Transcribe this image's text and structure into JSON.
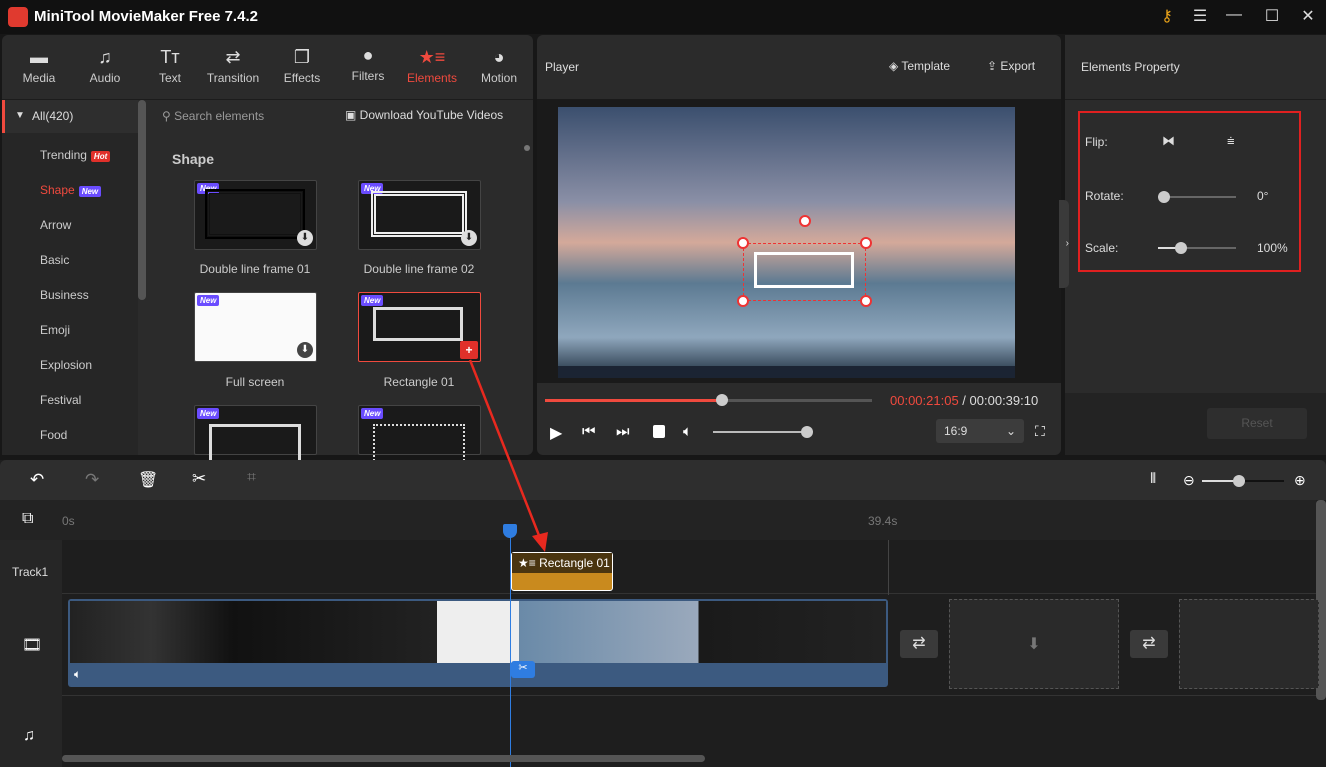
{
  "app": {
    "title": "MiniTool MovieMaker Free 7.4.2"
  },
  "toolbar": [
    {
      "label": "Media",
      "icon": "folder-icon"
    },
    {
      "label": "Audio",
      "icon": "music-icon"
    },
    {
      "label": "Text",
      "icon": "text-icon"
    },
    {
      "label": "Transition",
      "icon": "transition-icon"
    },
    {
      "label": "Effects",
      "icon": "effects-icon"
    },
    {
      "label": "Filters",
      "icon": "filters-icon"
    },
    {
      "label": "Elements",
      "icon": "elements-icon",
      "active": true
    },
    {
      "label": "Motion",
      "icon": "motion-icon"
    }
  ],
  "categories": {
    "all": "All(420)",
    "items": [
      {
        "label": "Trending",
        "badge": "Hot"
      },
      {
        "label": "Shape",
        "badge": "New",
        "active": true
      },
      {
        "label": "Arrow"
      },
      {
        "label": "Basic"
      },
      {
        "label": "Business"
      },
      {
        "label": "Emoji"
      },
      {
        "label": "Explosion"
      },
      {
        "label": "Festival"
      },
      {
        "label": "Food"
      }
    ]
  },
  "search": {
    "placeholder": "Search elements",
    "download": "Download YouTube Videos"
  },
  "section": "Shape",
  "elements": [
    {
      "name": "Double line frame 01",
      "tag": "New"
    },
    {
      "name": "Double line frame 02",
      "tag": "New"
    },
    {
      "name": "Full screen",
      "tag": "New"
    },
    {
      "name": "Rectangle 01",
      "tag": "New",
      "selected": true
    },
    {
      "tag": "New"
    },
    {
      "tag": "New"
    }
  ],
  "player": {
    "title": "Player",
    "template": "Template",
    "export": "Export",
    "current": "00:00:21:05",
    "separator": " / ",
    "total": "00:00:39:10",
    "progress": 0.54,
    "volume": 1.0,
    "aspect": "16:9"
  },
  "property": {
    "title": "Elements Property",
    "flip": "Flip:",
    "rotate": "Rotate:",
    "rotate_value": "0°",
    "rotate_level": 0,
    "scale": "Scale:",
    "scale_value": "100%",
    "scale_level": 0.3,
    "reset": "Reset"
  },
  "timeline": {
    "start": "0s",
    "end": "39.4s",
    "track1": "Track1",
    "clip": "Rectangle 01",
    "zoom_level": 0.45
  },
  "colors": {
    "accent": "#f04a3e",
    "clip": "#c98a1e",
    "playhead": "#2f7de1"
  }
}
